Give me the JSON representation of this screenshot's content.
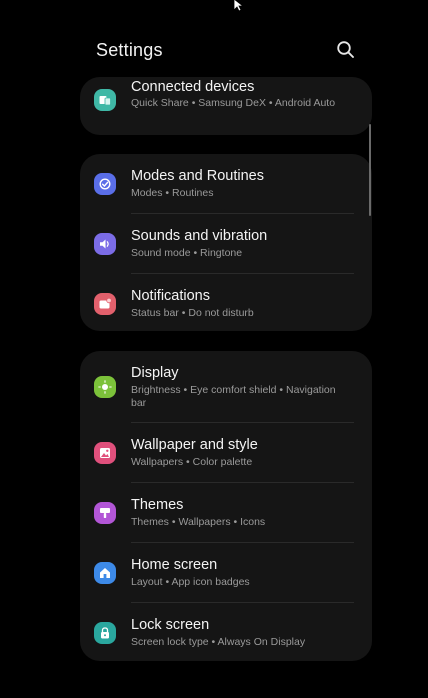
{
  "header": {
    "title": "Settings",
    "search_icon": "search-icon"
  },
  "groups": [
    {
      "items": [
        {
          "label": "Connected devices",
          "sub": "Quick Share • Samsung DeX • Android Auto",
          "icon": "connected-devices-icon",
          "color": "#3fb8a6"
        }
      ]
    },
    {
      "items": [
        {
          "label": "Modes and Routines",
          "sub": "Modes • Routines",
          "icon": "modes-routines-icon",
          "color": "#5a6ee8"
        },
        {
          "label": "Sounds and vibration",
          "sub": "Sound mode • Ringtone",
          "icon": "sound-icon",
          "color": "#7b6ce6"
        },
        {
          "label": "Notifications",
          "sub": "Status bar • Do not disturb",
          "icon": "notifications-icon",
          "color": "#e2606c"
        }
      ]
    },
    {
      "items": [
        {
          "label": "Display",
          "sub": "Brightness • Eye comfort shield • Navigation bar",
          "icon": "display-icon",
          "color": "#7cc23a"
        },
        {
          "label": "Wallpaper and style",
          "sub": "Wallpapers • Color palette",
          "icon": "wallpaper-icon",
          "color": "#e0507c"
        },
        {
          "label": "Themes",
          "sub": "Themes • Wallpapers • Icons",
          "icon": "themes-icon",
          "color": "#b256d6"
        },
        {
          "label": "Home screen",
          "sub": "Layout • App icon badges",
          "icon": "home-screen-icon",
          "color": "#3d8ae8"
        },
        {
          "label": "Lock screen",
          "sub": "Screen lock type • Always On Display",
          "icon": "lock-screen-icon",
          "color": "#2aa79e"
        }
      ]
    }
  ]
}
